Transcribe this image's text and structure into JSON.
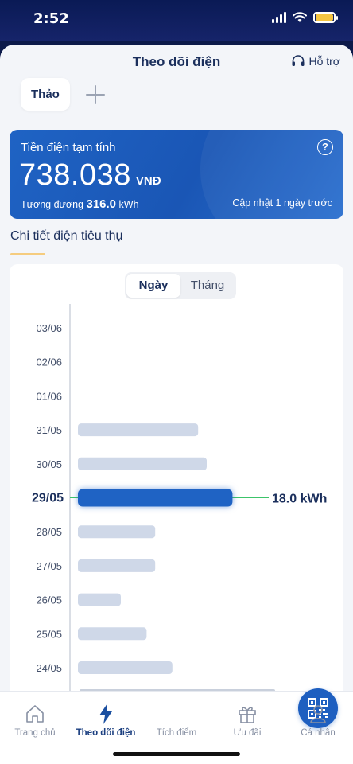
{
  "status_bar": {
    "time": "2:52"
  },
  "header": {
    "title": "Theo dõi điện",
    "help_label": "Hỗ trợ"
  },
  "accounts": {
    "selected": "Thảo"
  },
  "bill": {
    "label": "Tiền điện tạm tính",
    "amount": "738.038",
    "currency": "VNĐ",
    "equiv_label": "Tương đương",
    "equiv_value": "316.0",
    "equiv_unit": "kWh",
    "updated": "Cập nhật 1 ngày trước"
  },
  "section": {
    "title": "Chi tiết điện tiêu thụ"
  },
  "tabs": [
    {
      "label": "Ngày",
      "active": true
    },
    {
      "label": "Tháng",
      "active": false
    }
  ],
  "chart_data": {
    "type": "bar",
    "orientation": "horizontal",
    "unit": "kWh",
    "categories": [
      "03/06",
      "02/06",
      "01/06",
      "31/05",
      "30/05",
      "29/05",
      "28/05",
      "27/05",
      "26/05",
      "25/05",
      "24/05"
    ],
    "values": [
      0,
      0,
      0,
      14.0,
      15.0,
      18.0,
      9.0,
      9.0,
      5.0,
      8.0,
      11.0
    ],
    "selected_index": 5,
    "selected_label": "18.0 kWh",
    "colors": {
      "bar": "#cfd8e8",
      "selected": "#1f63c4",
      "guide": "#3cc46a",
      "axis": "#b5bccb"
    }
  },
  "bottom_nav": {
    "items": [
      {
        "label": "Trang chủ",
        "icon": "home-icon",
        "active": false
      },
      {
        "label": "Theo dõi điện",
        "icon": "lightning-icon",
        "active": true
      },
      {
        "label": "Tích điểm",
        "icon": "qr-code-icon",
        "active": false
      },
      {
        "label": "Ưu đãi",
        "icon": "gift-icon",
        "active": false
      },
      {
        "label": "Cá nhân",
        "icon": "user-icon",
        "active": false
      }
    ]
  }
}
